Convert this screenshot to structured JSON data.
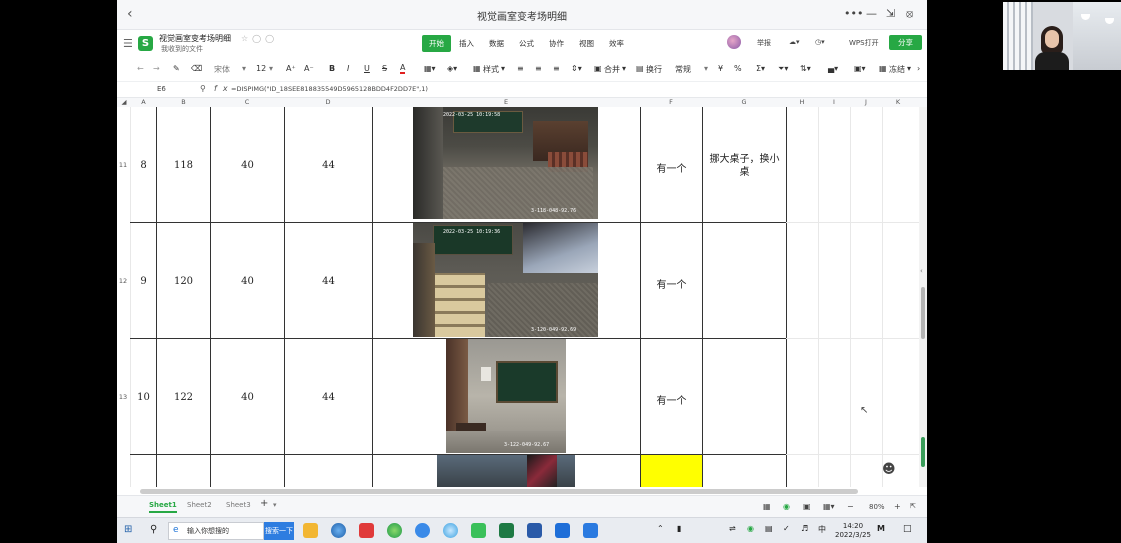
{
  "window": {
    "title": "视觉画室变考场明细",
    "file_name": "视觉画室变考场明细",
    "file_location": "我收到的文件"
  },
  "menu": {
    "tabs": [
      "开始",
      "插入",
      "数据",
      "公式",
      "协作",
      "视图",
      "效率"
    ],
    "report": "举报",
    "wps_open": "WPS打开",
    "share": "分享"
  },
  "toolbar": {
    "font_name": "宋体",
    "font_size": "12",
    "style_label": "样式",
    "merge_label": "合并",
    "wrap_label": "换行",
    "number_format": "常规",
    "freeze_label": "冻结"
  },
  "formula_bar": {
    "cell_ref": "E6",
    "fx": "fx",
    "formula": "=DISPIMG(\"ID_18SEE818835549D5965128BDD4F2DD7E\",1)"
  },
  "columns": [
    "A",
    "B",
    "C",
    "D",
    "E",
    "F",
    "G",
    "H",
    "I",
    "J",
    "K"
  ],
  "rows": [
    {
      "rownum": "11",
      "a": "8",
      "b": "118",
      "c": "40",
      "d": "44",
      "f": "有一个",
      "g": "挪大桌子，换小桌",
      "photo_ts": "2022-03-25 10:19:58",
      "photo_id": "3-118-048-92.76"
    },
    {
      "rownum": "12",
      "a": "9",
      "b": "120",
      "c": "40",
      "d": "44",
      "f": "有一个",
      "g": "",
      "photo_ts": "2022-03-25 10:19:36",
      "photo_id": "3-120-049-92.69"
    },
    {
      "rownum": "13",
      "a": "10",
      "b": "122",
      "c": "40",
      "d": "44",
      "f": "有一个",
      "g": "",
      "photo_ts": "",
      "photo_id": "3-122-049-92.67"
    }
  ],
  "sheets": [
    "Sheet1",
    "Sheet2",
    "Sheet3"
  ],
  "status": {
    "zoom": "80%"
  },
  "taskbar": {
    "search_placeholder": "输入你想搜的",
    "search_button": "搜索一下",
    "ime": "中",
    "time": "14:20",
    "date": "2022/3/25"
  },
  "colors": {
    "accent": "#27a844",
    "highlight": "#ffff00"
  }
}
